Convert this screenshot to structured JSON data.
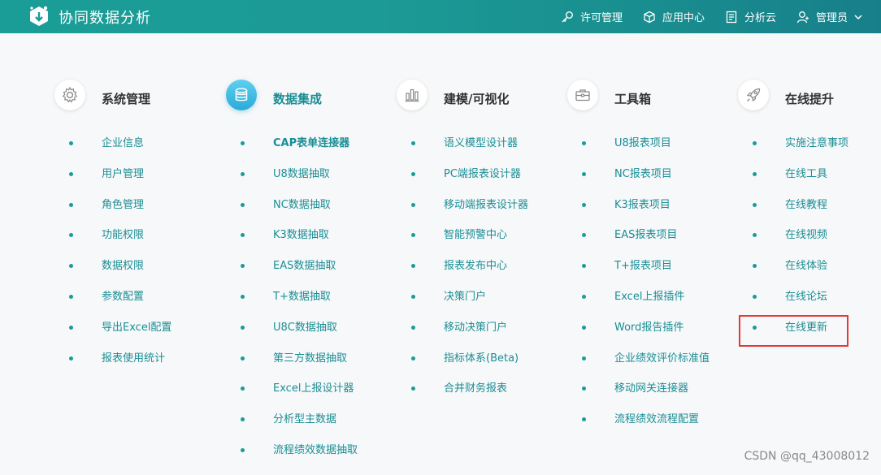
{
  "header": {
    "app_title": "协同数据分析",
    "nav": [
      {
        "label": "许可管理",
        "icon": "key-icon"
      },
      {
        "label": "应用中心",
        "icon": "cube-icon"
      },
      {
        "label": "分析云",
        "icon": "document-icon"
      },
      {
        "label": "管理员",
        "icon": "user-icon"
      }
    ]
  },
  "columns": [
    {
      "title": "系统管理",
      "icon": "gear-icon",
      "active": false,
      "items": [
        "企业信息",
        "用户管理",
        "角色管理",
        "功能权限",
        "数据权限",
        "参数配置",
        "导出Excel配置",
        "报表使用统计"
      ]
    },
    {
      "title": "数据集成",
      "icon": "database-icon",
      "active": true,
      "items": [
        "CAP表单连接器",
        "U8数据抽取",
        "NC数据抽取",
        "K3数据抽取",
        "EAS数据抽取",
        "T+数据抽取",
        "U8C数据抽取",
        "第三方数据抽取",
        "Excel上报设计器",
        "分析型主数据",
        "流程绩效数据抽取"
      ]
    },
    {
      "title": "建模/可视化",
      "icon": "bar-chart-icon",
      "active": false,
      "items": [
        "语义模型设计器",
        "PC端报表设计器",
        "移动端报表设计器",
        "智能预警中心",
        "报表发布中心",
        "决策门户",
        "移动决策门户",
        "指标体系(Beta)",
        "合并财务报表"
      ]
    },
    {
      "title": "工具箱",
      "icon": "toolbox-icon",
      "active": false,
      "items": [
        "U8报表项目",
        "NC报表项目",
        "K3报表项目",
        "EAS报表项目",
        "T+报表项目",
        "Excel上报插件",
        "Word报告插件",
        "企业绩效评价标准值",
        "移动网关连接器",
        "流程绩效流程配置"
      ]
    },
    {
      "title": "在线提升",
      "icon": "rocket-icon",
      "active": false,
      "items": [
        "实施注意事项",
        "在线工具",
        "在线教程",
        "在线视频",
        "在线体验",
        "在线论坛",
        "在线更新"
      ]
    }
  ],
  "watermark": "CSDN @qq_43008012",
  "colors": {
    "accent": "#1a9c97",
    "link": "#1a8e95",
    "highlight": "#e53935"
  }
}
